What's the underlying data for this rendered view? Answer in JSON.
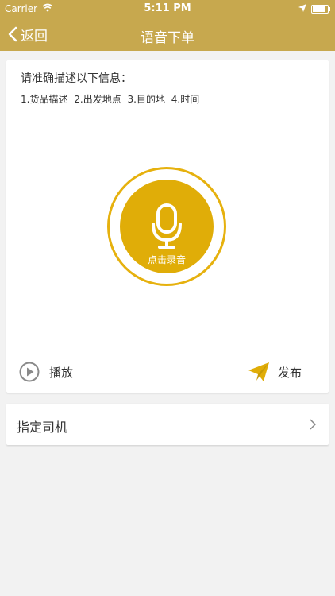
{
  "status_bar": {
    "carrier": "Carrier",
    "time": "5:11 PM"
  },
  "nav": {
    "back_label": "返回",
    "title": "语音下单"
  },
  "card": {
    "prompt": "请准确描述以下信息：",
    "hints": "1.货品描述 2.出发地点 3.目的地 4.时间",
    "record_label": "点击录音",
    "play_label": "播放",
    "publish_label": "发布"
  },
  "driver_row": {
    "label": "指定司机"
  },
  "colors": {
    "header": "#c7a84e",
    "accent": "#e0ad08",
    "background": "#f2f2f2"
  }
}
